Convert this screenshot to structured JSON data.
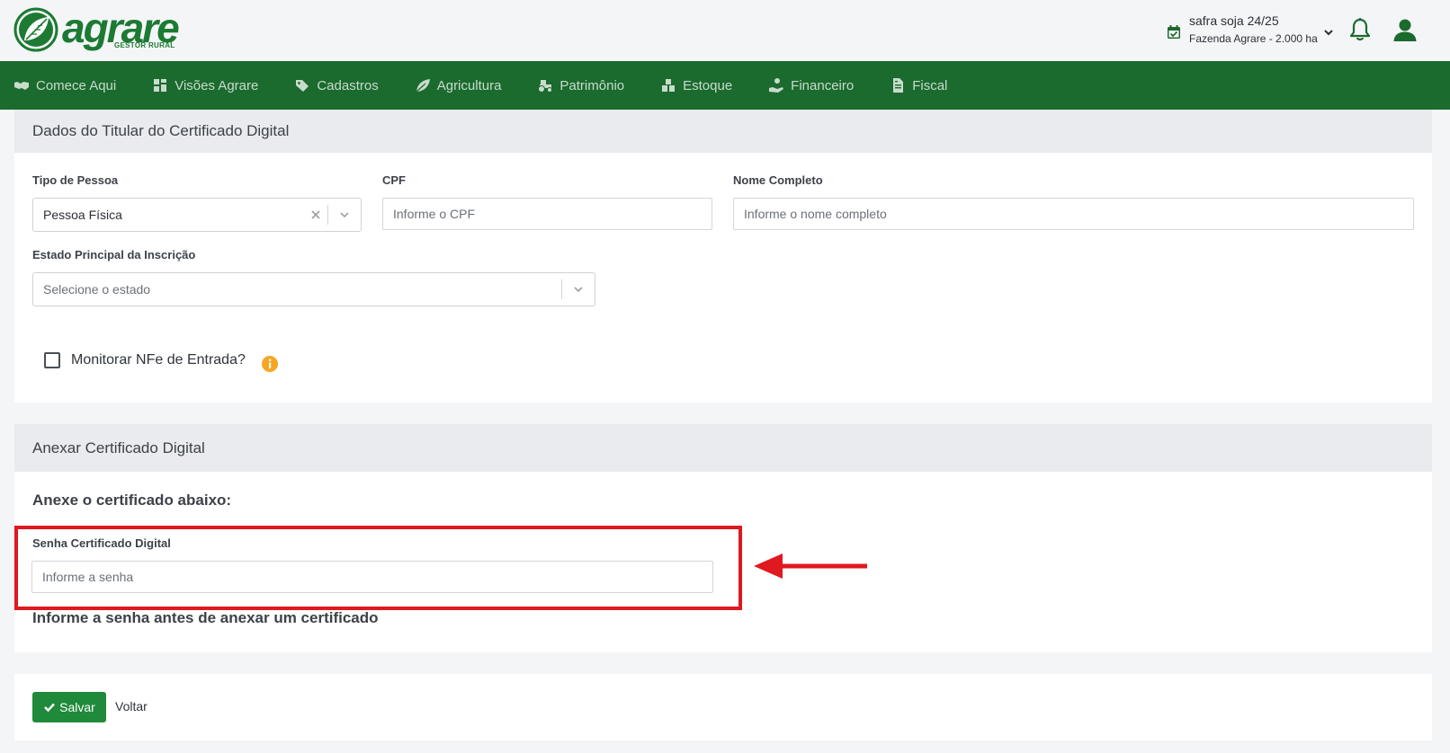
{
  "brand": {
    "name": "agrare",
    "tagline": "GESTOR RURAL",
    "color": "#1c7a33"
  },
  "header": {
    "season_name": "safra soja 24/25",
    "season_farm": "Fazenda Agrare - 2.000 ha",
    "icons": [
      "calendar-check-icon",
      "chevron-down-icon",
      "bell-icon",
      "user-icon"
    ]
  },
  "nav": {
    "items": [
      {
        "label": "Comece Aqui",
        "icon": "handshake-icon"
      },
      {
        "label": "Visões Agrare",
        "icon": "dashboard-icon"
      },
      {
        "label": "Cadastros",
        "icon": "tags-icon"
      },
      {
        "label": "Agricultura",
        "icon": "leaf-icon"
      },
      {
        "label": "Patrimônio",
        "icon": "tractor-icon"
      },
      {
        "label": "Estoque",
        "icon": "boxes-icon"
      },
      {
        "label": "Financeiro",
        "icon": "hand-coin-icon"
      },
      {
        "label": "Fiscal",
        "icon": "file-invoice-icon"
      }
    ],
    "background": "#1b6a2e"
  },
  "titular": {
    "title": "Dados do Titular do Certificado Digital",
    "tipo_pessoa": {
      "label": "Tipo de Pessoa",
      "value": "Pessoa Física"
    },
    "cpf": {
      "label": "CPF",
      "placeholder": "Informe o CPF"
    },
    "nome": {
      "label": "Nome Completo",
      "placeholder": "Informe o nome completo"
    },
    "estado": {
      "label": "Estado Principal da Inscrição",
      "placeholder": "Selecione o estado"
    },
    "monitorar": {
      "label": "Monitorar NFe de Entrada?",
      "checked": false
    }
  },
  "anexar": {
    "title": "Anexar Certificado Digital",
    "subheading": "Anexe o certificado abaixo:",
    "senha": {
      "label": "Senha Certificado Digital",
      "placeholder": "Informe a senha"
    },
    "hint": "Informe a senha antes de anexar um certificado"
  },
  "actions": {
    "save_label": "Salvar",
    "back_label": "Voltar",
    "save_color": "#1f8a3a"
  },
  "annotation": {
    "color": "#e0191f"
  }
}
